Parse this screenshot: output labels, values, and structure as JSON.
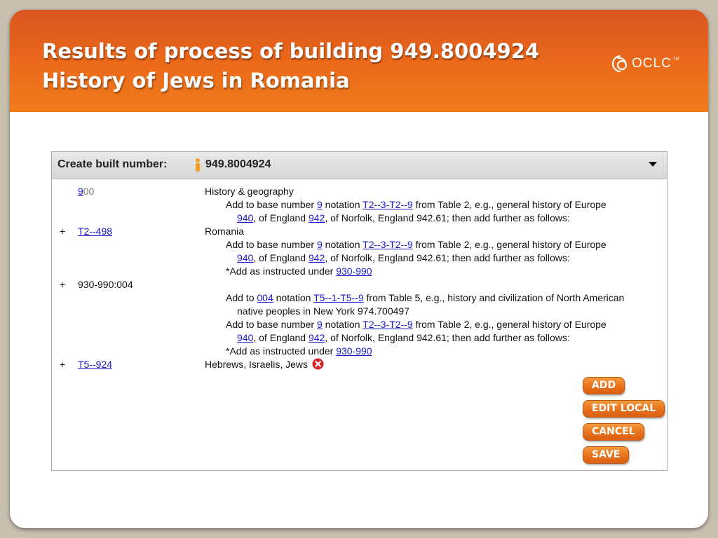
{
  "slide": {
    "title_line1": "Results of process of building 949.8004924",
    "title_line2": "History of Jews in Romania",
    "logo_text": "OCLC",
    "logo_tm": "TM"
  },
  "panel": {
    "label": "Create built number:",
    "number": "949.8004924"
  },
  "rows": {
    "r1": {
      "num_highlight": "9",
      "num_rest": "00",
      "text": "History & geography"
    },
    "r1_note1": {
      "pre": "Add to base number ",
      "link1": "9",
      "mid": " notation ",
      "link2": "T2--3-T2--9",
      "post": " from Table 2, e.g., general history of Europe"
    },
    "r1_note2": {
      "link1": "940",
      "mid": ", of England ",
      "link2": "942",
      "post": ", of Norfolk, England 942.61; then add further as follows:"
    },
    "r2": {
      "plus": "+",
      "num": "T2--498",
      "text": "Romania"
    },
    "r2_note1": {
      "pre": "Add to base number ",
      "link1": "9",
      "mid": " notation ",
      "link2": "T2--3-T2--9",
      "post": " from Table 2, e.g., general history of Europe"
    },
    "r2_note2": {
      "link1": "940",
      "mid": ", of England ",
      "link2": "942",
      "post": ", of Norfolk, England 942.61; then add further as follows:"
    },
    "r2_note3": {
      "pre": "*Add as instructed under ",
      "link1": "930-990"
    },
    "r3": {
      "plus": "+",
      "num": "930-990:004"
    },
    "r3_note1": {
      "pre": "Add to ",
      "link1": "004",
      "mid": " notation ",
      "link2": "T5--1-T5--9",
      "post": " from Table 5, e.g., history and civilization of North American"
    },
    "r3_note2": {
      "text": "native peoples in New York 974.700497"
    },
    "r3_note3": {
      "pre": "Add to base number ",
      "link1": "9",
      "mid": " notation ",
      "link2": "T2--3-T2--9",
      "post": " from Table 2, e.g., general history of Europe"
    },
    "r3_note4": {
      "link1": "940",
      "mid": ", of England ",
      "link2": "942",
      "post": ", of Norfolk, England 942.61; then add further as follows:"
    },
    "r3_note5": {
      "pre": "*Add as instructed under ",
      "link1": "930-990"
    },
    "r4": {
      "plus": "+",
      "num": "T5--924",
      "text": "Hebrews, Israelis, Jews"
    }
  },
  "buttons": {
    "add": "ADD",
    "edit_local": "EDIT LOCAL",
    "cancel": "CANCEL",
    "save": "SAVE"
  },
  "colors": {
    "header_orange": "#ec6a1a",
    "button_orange": "#e8711b",
    "link_blue": "#1a1acc",
    "delete_red": "#d9242b"
  }
}
